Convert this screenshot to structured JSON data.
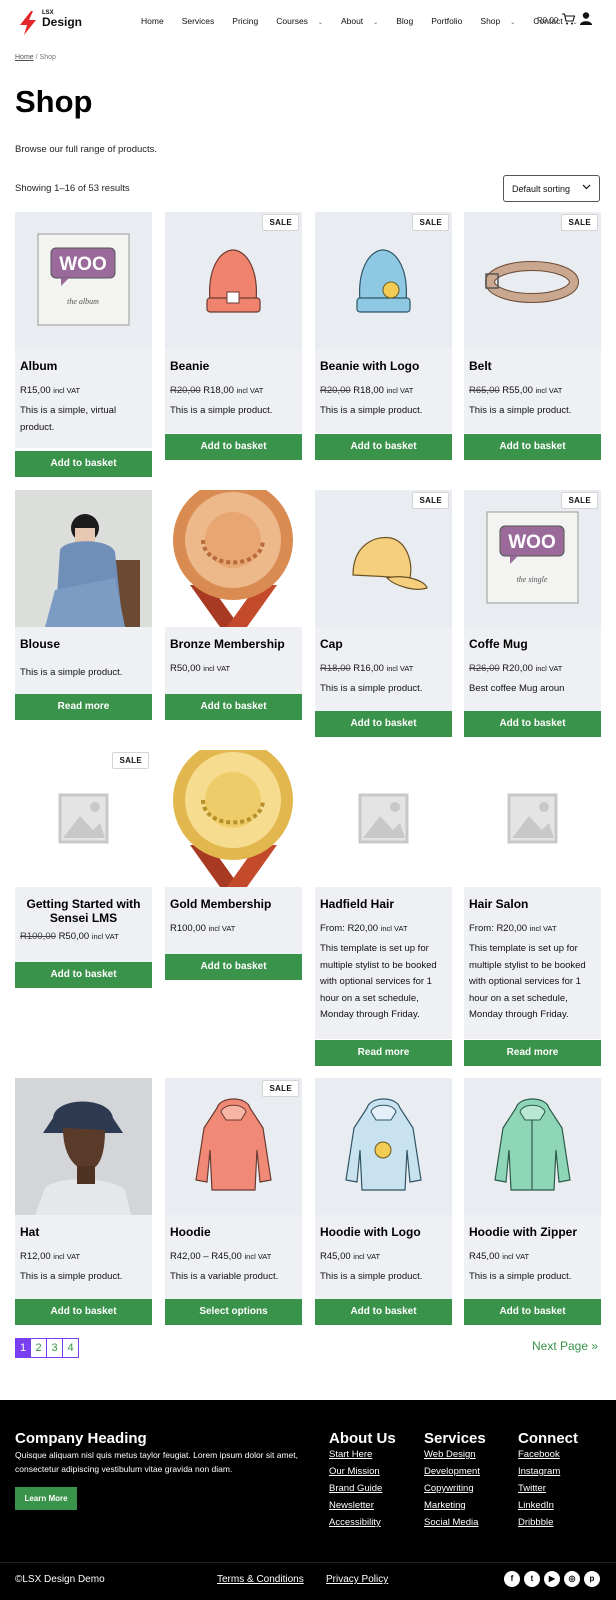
{
  "header": {
    "logo_top": "LSX",
    "logo_main": "Design",
    "nav": [
      {
        "label": "Home",
        "caret": false
      },
      {
        "label": "Services",
        "caret": false
      },
      {
        "label": "Pricing",
        "caret": false
      },
      {
        "label": "Courses",
        "caret": true
      },
      {
        "label": "About",
        "caret": true
      },
      {
        "label": "Blog",
        "caret": false
      },
      {
        "label": "Portfolio",
        "caret": false
      },
      {
        "label": "Shop",
        "caret": true
      },
      {
        "label": "Contact",
        "caret": true
      }
    ],
    "cart_amount": "R0,00",
    "cart_icon": "cart-icon",
    "user_icon": "user-icon"
  },
  "breadcrumb": {
    "home": "Home",
    "sep": " / ",
    "current": "Shop"
  },
  "page": {
    "title": "Shop",
    "intro": "Browse our full range of products.",
    "result_count": "Showing 1–16 of 53 results",
    "sort_value": "Default sorting"
  },
  "products": [
    {
      "name": "Album",
      "image": "woo-album",
      "sale": false,
      "price_old": "",
      "price": "R15,00",
      "vat": "incl VAT",
      "desc": "This is a simple, virtual product.",
      "button": "Add to basket"
    },
    {
      "name": "Beanie",
      "image": "beanie",
      "sale": true,
      "price_old": "R20,00",
      "price": "R18,00",
      "vat": "incl VAT",
      "desc": "This is a simple product.",
      "button": "Add to basket"
    },
    {
      "name": "Beanie with Logo",
      "image": "beanie-logo",
      "sale": true,
      "price_old": "R20,00",
      "price": "R18,00",
      "vat": "incl VAT",
      "desc": "This is a simple product.",
      "button": "Add to basket"
    },
    {
      "name": "Belt",
      "image": "belt",
      "sale": true,
      "price_old": "R65,00",
      "price": "R55,00",
      "vat": "incl VAT",
      "desc": "This is a simple product.",
      "button": "Add to basket"
    },
    {
      "name": "Blouse",
      "image": "blouse-photo",
      "sale": false,
      "price_old": "",
      "price": "",
      "vat": "",
      "desc": "This is a simple product.",
      "button": "Read more"
    },
    {
      "name": "Bronze Membership",
      "image": "bronze-medal",
      "sale": false,
      "price_old": "",
      "price": "R50,00",
      "vat": "incl VAT",
      "desc": "",
      "button": "Add to basket"
    },
    {
      "name": "Cap",
      "image": "cap",
      "sale": true,
      "price_old": "R18,00",
      "price": "R16,00",
      "vat": "incl VAT",
      "desc": "This is a simple product.",
      "button": "Add to basket"
    },
    {
      "name": "Coffe Mug",
      "image": "woo-single",
      "sale": true,
      "price_old": "R26,00",
      "price": "R20,00",
      "vat": "incl VAT",
      "desc": "Best coffee Mug aroun",
      "button": "Add to basket"
    },
    {
      "name": "Getting Started with Sensei LMS",
      "image": "placeholder",
      "sale": true,
      "price_old": "R100,00",
      "price": "R50,00",
      "vat": "incl VAT",
      "desc": "",
      "button": "Add to basket"
    },
    {
      "name": "Gold Membership",
      "image": "gold-medal",
      "sale": false,
      "price_old": "",
      "price": "R100,00",
      "vat": "incl VAT",
      "desc": "",
      "button": "Add to basket"
    },
    {
      "name": "Hadfield Hair",
      "image": "placeholder",
      "sale": false,
      "price_old": "",
      "price": "From: R20,00",
      "vat": "incl VAT",
      "desc": "This template is set up for multiple stylist to be booked with optional services for 1 hour on a set schedule, Monday through Friday.",
      "button": "Read more"
    },
    {
      "name": "Hair Salon",
      "image": "placeholder",
      "sale": false,
      "price_old": "",
      "price": "From: R20,00",
      "vat": "incl VAT",
      "desc": "This template is set up for multiple stylist to be booked with optional services for 1 hour on a set schedule, Monday through Friday.",
      "button": "Read more"
    },
    {
      "name": "Hat",
      "image": "hat-photo",
      "sale": false,
      "price_old": "",
      "price": "R12,00",
      "vat": "incl VAT",
      "desc": "This is a simple product.",
      "button": "Add to basket"
    },
    {
      "name": "Hoodie",
      "image": "hoodie",
      "sale": true,
      "price_old": "",
      "price": "R42,00 – R45,00",
      "vat": "incl VAT",
      "desc": "This is a variable product.",
      "button": "Select options"
    },
    {
      "name": "Hoodie with Logo",
      "image": "hoodie-logo",
      "sale": false,
      "price_old": "",
      "price": "R45,00",
      "vat": "incl VAT",
      "desc": "This is a simple product.",
      "button": "Add to basket"
    },
    {
      "name": "Hoodie with Zipper",
      "image": "hoodie-zip",
      "sale": false,
      "price_old": "",
      "price": "R45,00",
      "vat": "incl VAT",
      "desc": "This is a simple product.",
      "button": "Add to basket"
    }
  ],
  "sale_label": "SALE",
  "pagination": {
    "pages": [
      "1",
      "2",
      "3",
      "4"
    ],
    "current": "1",
    "next": "Next Page  »"
  },
  "footer": {
    "company_heading": "Company Heading",
    "company_text": "Quisque aliquam nisl quis metus taylor feugiat. Lorem ipsum dolor sit amet, consectetur adipiscing vestibulum vitae gravida non diam.",
    "learn_more": "Learn More",
    "about": {
      "heading": "About Us",
      "links": [
        "Start Here",
        "Our Mission",
        "Brand Guide",
        "Newsletter",
        "Accessibility"
      ]
    },
    "services": {
      "heading": "Services",
      "links": [
        "Web Design",
        "Development",
        "Copywriting",
        "Marketing",
        "Social Media"
      ]
    },
    "connect": {
      "heading": "Connect",
      "links": [
        "Facebook",
        "Instagram",
        "Twitter",
        "LinkedIn",
        "Dribbble"
      ]
    },
    "copyright": "©LSX Design Demo",
    "terms": "Terms & Conditions",
    "privacy": "Privacy Policy",
    "social_icons": [
      "facebook-icon",
      "twitter-icon",
      "youtube-icon",
      "instagram-icon",
      "pinterest-icon"
    ]
  },
  "colors": {
    "accent_green": "#3a934a",
    "pager_purple": "#7b3ff2",
    "logo_red": "#e5262a"
  }
}
